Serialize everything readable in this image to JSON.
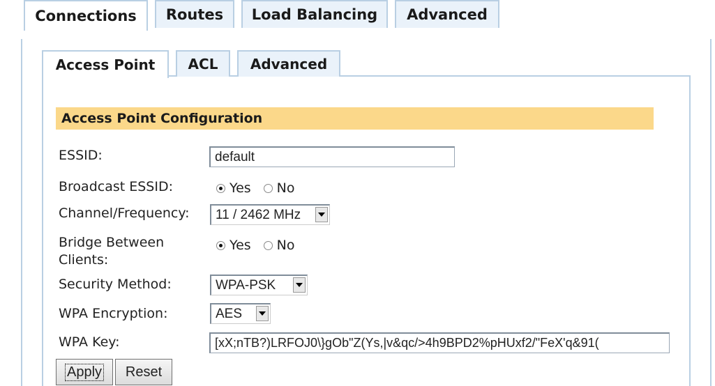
{
  "top_tabs": [
    {
      "label": "Connections",
      "active": true
    },
    {
      "label": "Routes",
      "active": false
    },
    {
      "label": "Load Balancing",
      "active": false
    },
    {
      "label": "Advanced",
      "active": false
    }
  ],
  "sub_tabs": [
    {
      "label": "Access Point",
      "active": true
    },
    {
      "label": "ACL",
      "active": false
    },
    {
      "label": "Advanced",
      "active": false
    }
  ],
  "section": {
    "title": "Access Point Configuration"
  },
  "form": {
    "essid": {
      "label": "ESSID:",
      "value": "default"
    },
    "broadcast_essid": {
      "label": "Broadcast ESSID:",
      "options": [
        "Yes",
        "No"
      ],
      "selected": "Yes"
    },
    "channel": {
      "label": "Channel/Frequency:",
      "value": "11 / 2462 MHz"
    },
    "bridge": {
      "label_line1": "Bridge Between",
      "label_line2": "Clients:",
      "options": [
        "Yes",
        "No"
      ],
      "selected": "Yes"
    },
    "security_method": {
      "label": "Security Method:",
      "value": "WPA-PSK"
    },
    "wpa_encryption": {
      "label": "WPA Encryption:",
      "value": "AES"
    },
    "wpa_key": {
      "label": "WPA Key:",
      "value": "[xX;nTB?)LRFOJ0\\}gOb\"Z(Ys,|v&qc/>4h9BPD2%pHUxf2/\"FeX'q&91("
    }
  },
  "buttons": {
    "apply": "Apply",
    "reset": "Reset"
  }
}
